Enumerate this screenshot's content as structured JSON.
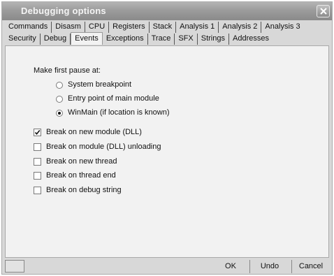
{
  "window": {
    "title": "Debugging options",
    "close_icon": "close-icon"
  },
  "tabs": {
    "row_back": [
      "Commands",
      "Disasm",
      "CPU",
      "Registers",
      "Stack",
      "Analysis 1",
      "Analysis 2",
      "Analysis 3"
    ],
    "row_front": [
      "Security",
      "Debug",
      "Events",
      "Exceptions",
      "Trace",
      "SFX",
      "Strings",
      "Addresses"
    ],
    "active": "Events"
  },
  "events": {
    "first_pause_label": "Make first pause at:",
    "pause_options": [
      {
        "label": "System breakpoint",
        "selected": false
      },
      {
        "label": "Entry point of main module",
        "selected": false
      },
      {
        "label": "WinMain (if location is known)",
        "selected": true
      }
    ],
    "break_options": [
      {
        "label": "Break on new module (DLL)",
        "checked": true
      },
      {
        "label": "Break on module (DLL) unloading",
        "checked": false
      },
      {
        "label": "Break on new thread",
        "checked": false
      },
      {
        "label": "Break on thread end",
        "checked": false
      },
      {
        "label": "Break on debug string",
        "checked": false
      }
    ]
  },
  "buttons": {
    "ok": "OK",
    "undo": "Undo",
    "cancel": "Cancel"
  },
  "colors": {
    "title_gradient_top": "#b4b4b4",
    "title_gradient_bottom": "#8a8a8a",
    "panel": "#f2f2f2",
    "dialog": "#d8d8d8"
  }
}
